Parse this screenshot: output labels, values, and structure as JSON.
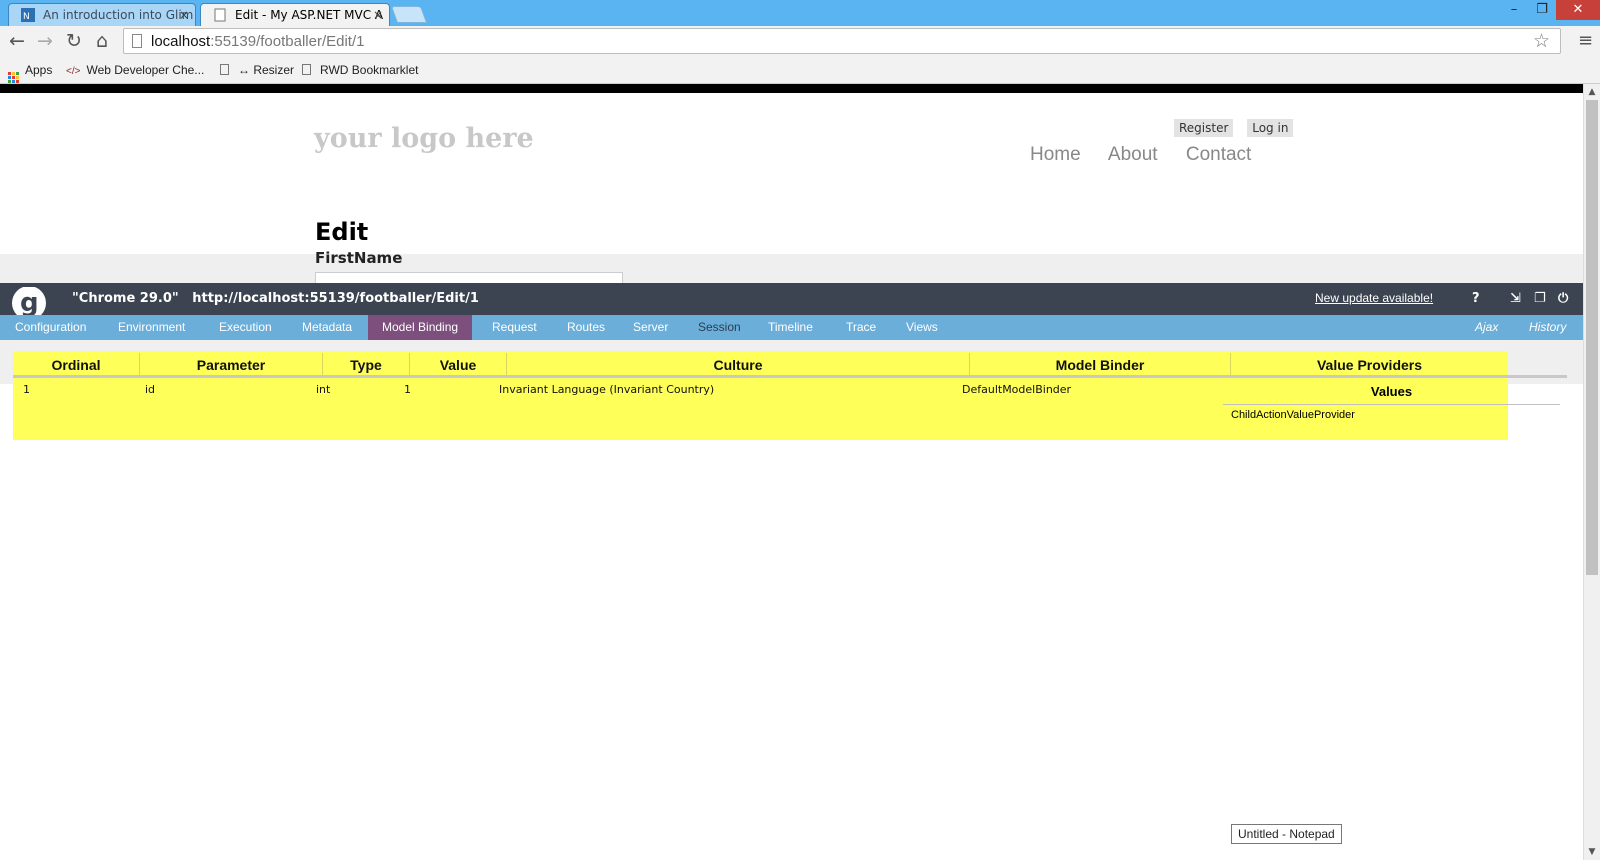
{
  "browser": {
    "tabs": [
      {
        "title": "An introduction into Glim",
        "close": "×"
      },
      {
        "title": "Edit - My ASP.NET MVC A",
        "close": "×"
      }
    ],
    "window_buttons": {
      "minimize": "–",
      "maximize": "❐",
      "close": "✕"
    },
    "nav": {
      "back": "←",
      "forward": "→",
      "reload": "↻",
      "home": "⌂",
      "menu": "≡",
      "star": "☆"
    },
    "address": {
      "host": "localhost",
      "rest": ":55139/footballer/Edit/1"
    },
    "bookmarks": [
      {
        "label": "Apps",
        "icon": "apps-grid-icon"
      },
      {
        "label": "Web Developer Che...",
        "icon": "code-icon",
        "glyph": "</>"
      },
      {
        "label": "↔ Resizer",
        "icon": "page-icon"
      },
      {
        "label": "RWD Bookmarklet",
        "icon": "page-icon"
      }
    ]
  },
  "site": {
    "logo": "your logo here",
    "account": {
      "register": "Register",
      "login": "Log in"
    },
    "nav": [
      "Home",
      "About",
      "Contact"
    ],
    "page_title": "Edit",
    "field_label": "FirstName"
  },
  "glimpse": {
    "title": "\"Chrome 29.0\"   http://localhost:55139/footballer/Edit/1",
    "update": "New update available!",
    "icons": {
      "help": "?",
      "popout": "⇲",
      "restore": "❐",
      "power": "⏻"
    },
    "tabs": [
      "Configuration",
      "Environment",
      "Execution",
      "Metadata",
      "Model Binding",
      "Request",
      "Routes",
      "Server",
      "Session",
      "Timeline",
      "Trace",
      "Views"
    ],
    "active_tab": "Model Binding",
    "right_tabs": [
      "Ajax",
      "History"
    ]
  },
  "model_binding": {
    "columns": [
      "Ordinal",
      "Parameter",
      "Type",
      "Value",
      "Culture",
      "Model Binder",
      "Value Providers"
    ],
    "rows": [
      {
        "ordinal": "1",
        "parameter": "id",
        "type": "int",
        "value": "1",
        "culture": "Invariant Language (Invariant Country)",
        "model_binder": "DefaultModelBinder"
      }
    ],
    "value_providers": {
      "header": "Values",
      "items": [
        "ChildActionValueProvider"
      ]
    }
  },
  "taskbar_tooltip": "Untitled - Notepad",
  "colors": {
    "highlight": "#ffff5a",
    "glimpse_header": "#3b4450",
    "glimpse_tabs": "#6aaed9",
    "active_tab": "#7c4f7c",
    "chrome_tabbar": "#5ab4f2"
  }
}
